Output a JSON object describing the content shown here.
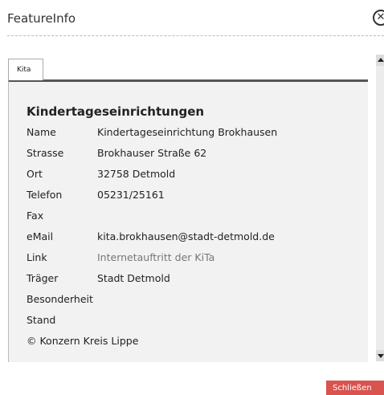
{
  "window": {
    "title": "FeatureInfo",
    "close_icon": "✕"
  },
  "tabs": [
    {
      "label": "Kita"
    }
  ],
  "feature": {
    "heading": "Kindertageseinrichtungen",
    "rows": [
      {
        "key": "Name",
        "value": "Kindertageseinrichtung Brokhausen"
      },
      {
        "key": "Strasse",
        "value": "Brokhauser Straße 62"
      },
      {
        "key": "Ort",
        "value": "32758 Detmold"
      },
      {
        "key": "Telefon",
        "value": "05231/25161"
      },
      {
        "key": "Fax",
        "value": ""
      },
      {
        "key": "eMail",
        "value": "kita.brokhausen@stadt-detmold.de"
      },
      {
        "key": "Link",
        "value": "Internetauftritt der KiTa"
      },
      {
        "key": "Träger",
        "value": "Stadt Detmold"
      },
      {
        "key": "Besonderheit",
        "value": ""
      },
      {
        "key": "Stand",
        "value": ""
      }
    ],
    "copyright": "© Konzern Kreis Lippe"
  },
  "footer": {
    "close_label": "Schließen"
  }
}
